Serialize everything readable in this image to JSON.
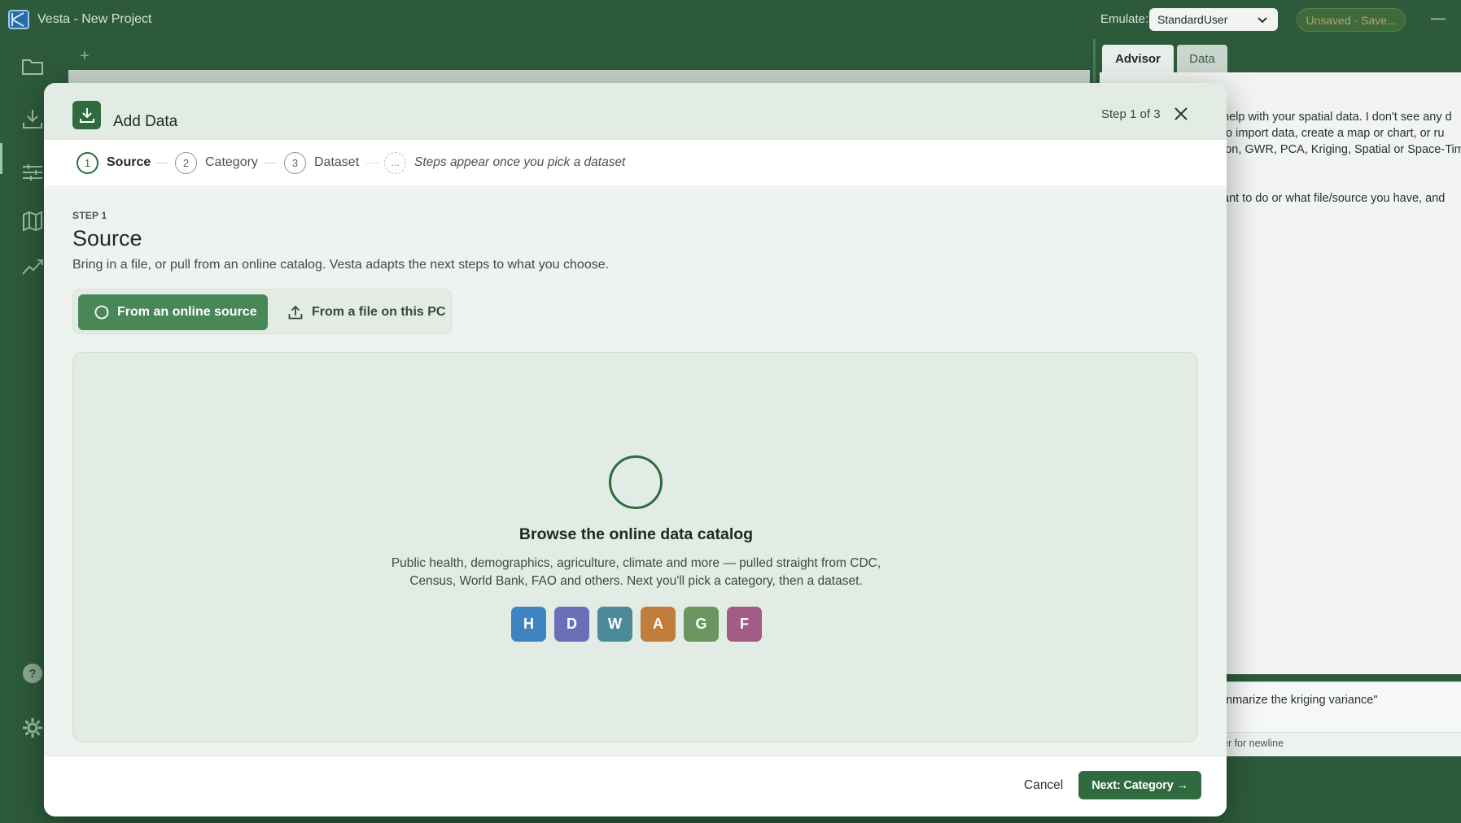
{
  "app": {
    "title": "Vesta - New Project"
  },
  "header": {
    "emulate_label": "Emulate:",
    "emulate_value": "StandardUser",
    "save_status": "Unsaved · Save..."
  },
  "right_panel": {
    "tabs": [
      "Advisor",
      "Data"
    ],
    "lines": [
      "help with your spatial data. I don't see any d",
      "to import data, create a map or chart, or ru",
      "ion, GWR, PCA, Kriging, Spatial or Space-Tim",
      "ant to do or what file/source you have, and"
    ],
    "input_text": "mmarize the kriging variance\"",
    "hint": "er for newline"
  },
  "modal": {
    "title": "Add Data",
    "step_counter": "Step 1 of 3",
    "steps": [
      {
        "num": "1",
        "label": "Source"
      },
      {
        "num": "2",
        "label": "Category"
      },
      {
        "num": "3",
        "label": "Dataset"
      }
    ],
    "step_ellipsis": "...",
    "steps_note": "Steps appear once you pick a dataset",
    "kicker": "STEP 1",
    "heading": "Source",
    "description": "Bring in a file, or pull from an online catalog. Vesta adapts the next steps to what you choose.",
    "source_options": {
      "online": "From an online source",
      "file": "From a file on this PC"
    },
    "catalog": {
      "title": "Browse the online data catalog",
      "desc_line1": "Public health, demographics, agriculture, climate and more — pulled straight from CDC,",
      "desc_line2": "Census, World Bank, FAO and others. Next you'll pick a category, then a dataset.",
      "badges": [
        {
          "letter": "H",
          "color": "#3f84c0"
        },
        {
          "letter": "D",
          "color": "#6b6fb8"
        },
        {
          "letter": "W",
          "color": "#4b8a98"
        },
        {
          "letter": "A",
          "color": "#c07d3c"
        },
        {
          "letter": "G",
          "color": "#6b9460"
        },
        {
          "letter": "F",
          "color": "#a25c86"
        }
      ]
    },
    "footer": {
      "cancel": "Cancel",
      "next": "Next: Category →"
    }
  }
}
